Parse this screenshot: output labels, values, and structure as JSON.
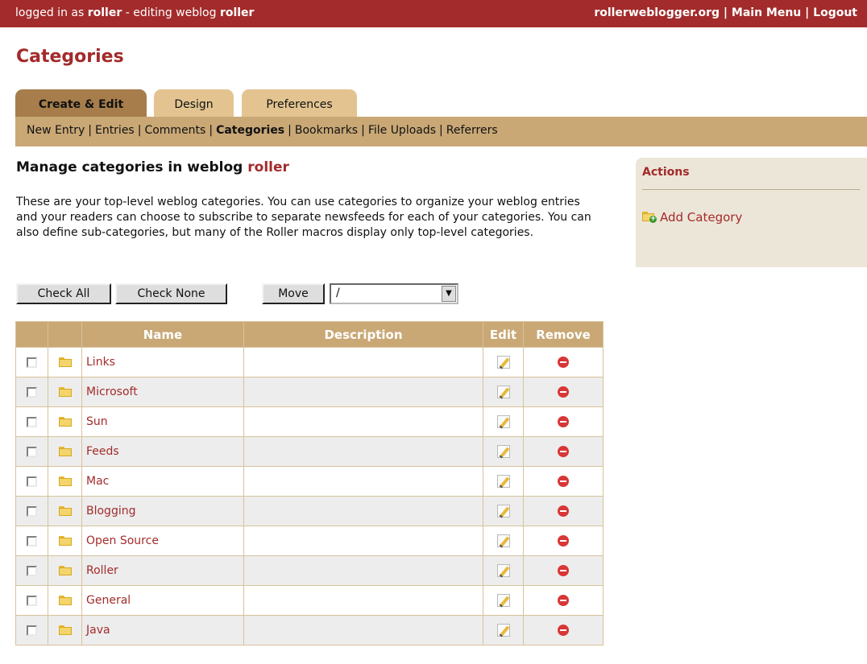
{
  "topbar": {
    "logged_in_prefix": "logged in as",
    "username": "roller",
    "editing_prefix": "- editing weblog",
    "weblog": "roller",
    "site_link": "rollerweblogger.org",
    "separator": "|",
    "main_menu": "Main Menu",
    "logout": "Logout"
  },
  "page_title": "Categories",
  "tabs": [
    {
      "label": "Create & Edit",
      "active": true
    },
    {
      "label": "Design",
      "active": false
    },
    {
      "label": "Preferences",
      "active": false
    }
  ],
  "subnav": {
    "items": [
      "New Entry",
      "Entries",
      "Comments",
      "Categories",
      "Bookmarks",
      "File Uploads",
      "Referrers"
    ],
    "current": "Categories",
    "separator": "|"
  },
  "section": {
    "heading_prefix": "Manage categories in weblog",
    "weblog": "roller",
    "intro": "These are your top-level weblog categories. You can use categories to organize your weblog entries and your readers can choose to subscribe to separate newsfeeds for each of your categories. You can also define sub-categories, but many of the Roller macros display only top-level categories."
  },
  "controls": {
    "check_all": "Check All",
    "check_none": "Check None",
    "move": "Move",
    "move_target": "/",
    "dropdown_arrow": "▼"
  },
  "table": {
    "headers": [
      "",
      "",
      "Name",
      "Description",
      "Edit",
      "Remove"
    ],
    "rows": [
      {
        "name": "Links",
        "description": ""
      },
      {
        "name": "Microsoft",
        "description": ""
      },
      {
        "name": "Sun",
        "description": ""
      },
      {
        "name": "Feeds",
        "description": ""
      },
      {
        "name": "Mac",
        "description": ""
      },
      {
        "name": "Blogging",
        "description": ""
      },
      {
        "name": "Open Source",
        "description": ""
      },
      {
        "name": "Roller",
        "description": ""
      },
      {
        "name": "General",
        "description": ""
      },
      {
        "name": "Java",
        "description": ""
      }
    ]
  },
  "sidebar": {
    "title": "Actions",
    "add_category": "Add Category"
  },
  "icons": {
    "row_icon": "folder-icon",
    "edit": "pencil-edit-icon",
    "remove": "remove-circle-icon",
    "add": "add-folder-icon"
  },
  "colors": {
    "brand_red": "#a32b2b",
    "tab_active": "#a67d4b",
    "tab_inactive": "#e3c491",
    "nav_tan": "#c9a876",
    "sidebar_bg": "#ece6d8"
  }
}
